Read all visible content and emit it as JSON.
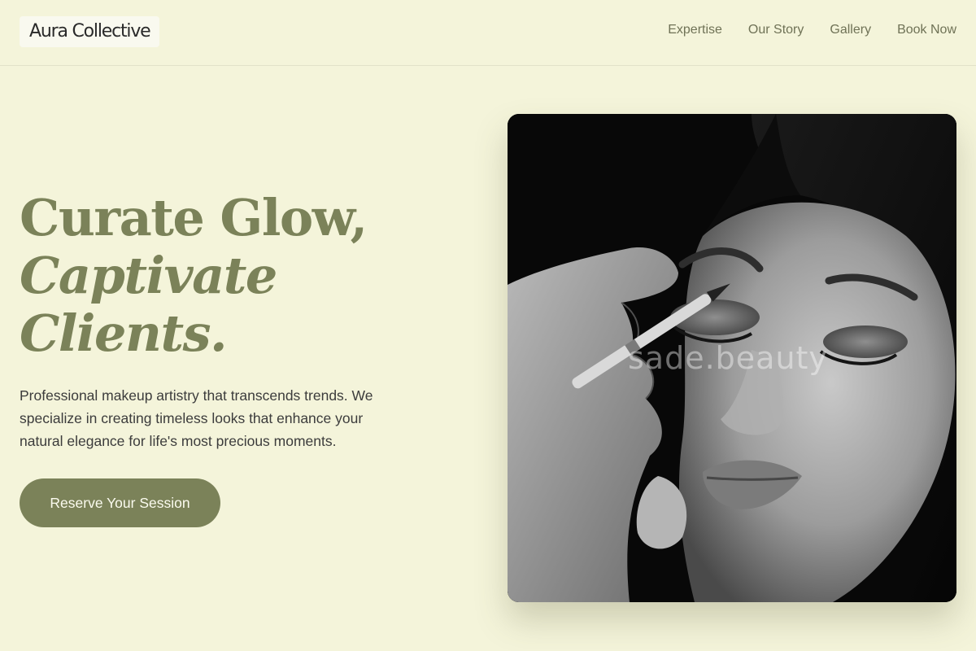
{
  "header": {
    "logo": "Aura Collective",
    "nav": [
      {
        "label": "Expertise"
      },
      {
        "label": "Our Story"
      },
      {
        "label": "Gallery"
      },
      {
        "label": "Book Now"
      }
    ]
  },
  "hero": {
    "title_line1": "Curate Glow,",
    "title_line2": "Captivate",
    "title_line3": "Clients.",
    "description": "Professional makeup artistry that transcends trends. We specialize in creating timeless looks that enhance your natural elegance for life's most precious moments.",
    "cta_label": "Reserve Your Session"
  },
  "photo": {
    "watermark": "sade.beauty"
  },
  "colors": {
    "background": "#f4f4da",
    "accent": "#7b8259",
    "text": "#3c3c3c"
  }
}
